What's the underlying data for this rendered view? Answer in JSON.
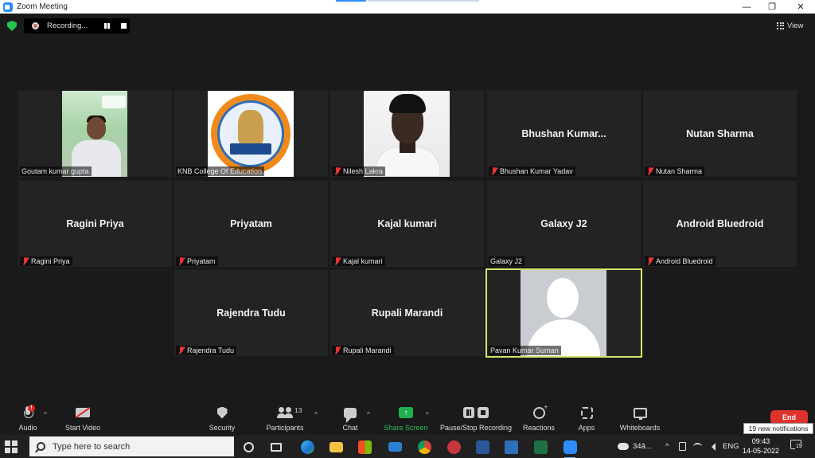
{
  "window": {
    "title": "Zoom Meeting",
    "minimize": "—",
    "restore": "❐",
    "close": "✕"
  },
  "topbar": {
    "recording_text": "Recording...",
    "view_label": "View"
  },
  "participants": [
    {
      "display": "",
      "label": "Goutam kumar gupta",
      "muted": false
    },
    {
      "display": "",
      "label": "KNB College Of Education",
      "muted": false
    },
    {
      "display": "",
      "label": "Nilesh Lakra",
      "muted": true
    },
    {
      "display": "Bhushan  Kumar...",
      "label": "Bhushan Kumar Yadav",
      "muted": true
    },
    {
      "display": "Nutan Sharma",
      "label": "Nutan Sharma",
      "muted": true
    },
    {
      "display": "Ragini Priya",
      "label": "Ragini Priya",
      "muted": true
    },
    {
      "display": "Priyatam",
      "label": "Priyatam",
      "muted": true
    },
    {
      "display": "Kajal kumari",
      "label": "Kajal kumari",
      "muted": true
    },
    {
      "display": "Galaxy J2",
      "label": "Galaxy J2",
      "muted": false
    },
    {
      "display": "Android Bluedroid",
      "label": "Android Bluedroid",
      "muted": true
    },
    {
      "display": "Rajendra Tudu",
      "label": "Rajendra Tudu",
      "muted": true
    },
    {
      "display": "Rupali Marandi",
      "label": "Rupali Marandi",
      "muted": true
    },
    {
      "display": "",
      "label": "Pavan Kumar Suman",
      "muted": false,
      "active_speaker": true
    }
  ],
  "toolbar": {
    "audio": "Audio",
    "audio_badge": "!",
    "start_video": "Start Video",
    "security": "Security",
    "participants": "Participants",
    "participants_count": "13",
    "chat": "Chat",
    "share_screen": "Share Screen",
    "pause_stop_recording": "Pause/Stop Recording",
    "reactions": "Reactions",
    "apps": "Apps",
    "whiteboards": "Whiteboards",
    "end": "End",
    "caret": "^"
  },
  "notification_tooltip": "19 new notifications",
  "taskbar": {
    "search_placeholder": "Type here to search",
    "weather": "34â...",
    "chevron": "^",
    "language": "ENG",
    "time": "09:43",
    "date": "14-05-2022",
    "notif_count": "19"
  },
  "colors": {
    "active_speaker_border": "#d8e36a",
    "share_green": "#1fb14f",
    "end_red": "#e0322d",
    "muted_red": "#ee3333"
  }
}
